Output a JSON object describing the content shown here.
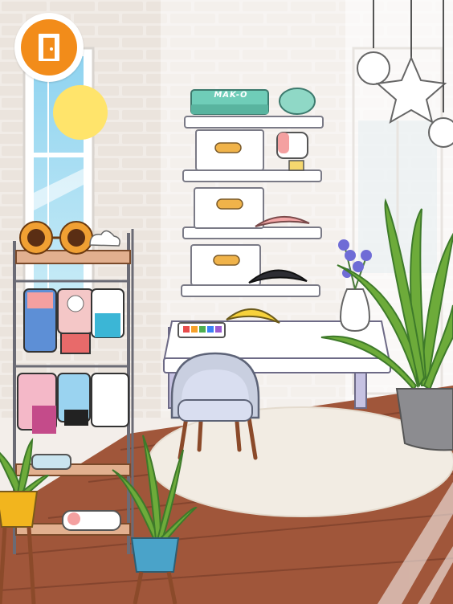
{
  "exit_button": {
    "icon": "door-exit-icon",
    "color": "#f28c1a"
  },
  "shelf_box_label": "MAK-O",
  "colors": {
    "wall": "#f1ece7",
    "brick_line": "#e6dfd8",
    "floor": "#a0563a",
    "floor_line": "#7a3e2a",
    "rug": "#f2ece3",
    "desk": "#ffffff",
    "chair": "#c9cfe0",
    "plant": "#6dab3a",
    "pot_gray": "#8c8c90",
    "pot_yellow": "#f2b51e",
    "pot_blue": "#4aa3c9"
  }
}
